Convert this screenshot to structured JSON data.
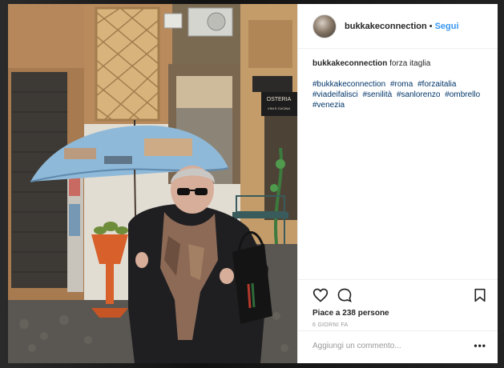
{
  "post": {
    "username": "bukkakeconnection",
    "separator": "•",
    "follow_label": "Segui",
    "caption_text": "forza itaglia",
    "hashtags": [
      "#bukkakeconnection",
      "#roma",
      "#forzaitalia",
      "#viadeifalisci",
      "#senilità",
      "#sanlorenzo",
      "#ombrello",
      "#venezia"
    ],
    "likes_text": "Piace a 238 persone",
    "time_ago": "6 GIORNI FA",
    "comment_placeholder": "Aggiungi un commento...",
    "more_label": "•••"
  },
  "photo": {
    "shop_sign_top": "OSTERIA",
    "shop_sign_bottom": "VINI E CUCINA"
  },
  "icons": {
    "like": "heart-icon",
    "comment": "speech-bubble-icon",
    "save": "bookmark-icon"
  },
  "colors": {
    "link": "#3897f0",
    "hashtag": "#003569",
    "text": "#262626",
    "muted": "#999999"
  }
}
